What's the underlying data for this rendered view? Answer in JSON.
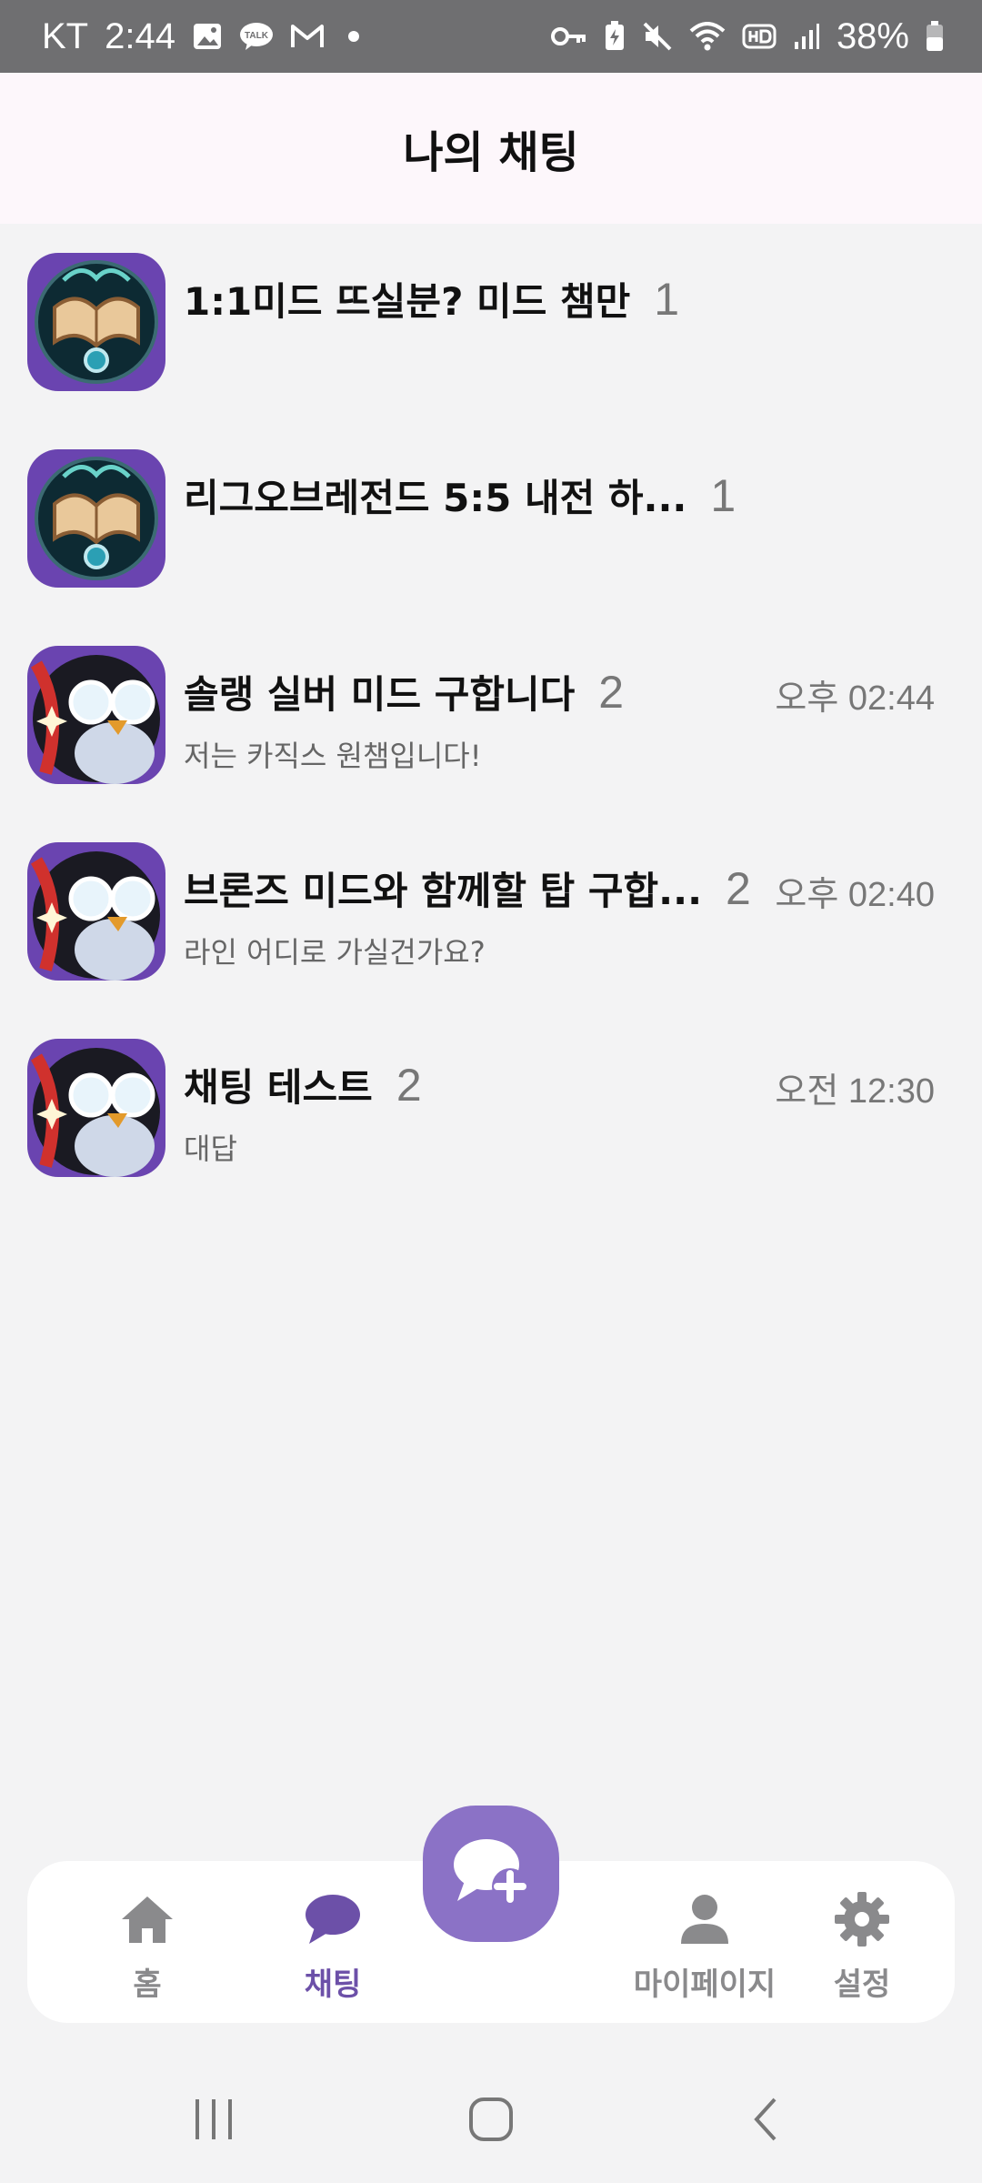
{
  "status_bar": {
    "carrier": "KT",
    "time": "2:44",
    "battery": "38%",
    "left_icons": [
      "image-icon",
      "talk-icon",
      "gmail-icon",
      "dot-icon"
    ],
    "right_icons": [
      "key-icon",
      "battery-saver-icon",
      "mute-icon",
      "wifi-icon",
      "hd-icon",
      "signal-icon",
      "battery-icon"
    ],
    "talk_badge": "TALK"
  },
  "header": {
    "title": "나의 채팅"
  },
  "chats": [
    {
      "title": "1:1미드 뜨실분? 미드 챔만",
      "count": "1",
      "time": "",
      "preview": "",
      "avatar": "book-emblem"
    },
    {
      "title": "리그오브레전드 5:5 내전 하...",
      "count": "1",
      "time": "",
      "preview": "",
      "avatar": "book-emblem"
    },
    {
      "title": "솔랭 실버 미드 구합니다",
      "count": "2",
      "time": "오후 02:44",
      "preview": "저는 카직스 원챔입니다!",
      "avatar": "penguin"
    },
    {
      "title": "브론즈 미드와 함께할 탑 구합...",
      "count": "2",
      "time": "오후 02:40",
      "preview": "라인 어디로 가실건가요?",
      "avatar": "penguin"
    },
    {
      "title": "채팅 테스트",
      "count": "2",
      "time": "오전 12:30",
      "preview": "대답",
      "avatar": "penguin"
    }
  ],
  "bottom_nav": {
    "items": [
      {
        "label": "홈",
        "icon": "home-icon"
      },
      {
        "label": "채팅",
        "icon": "chat-bubble-icon",
        "active": true
      },
      {
        "label": "마이페이지",
        "icon": "person-icon"
      },
      {
        "label": "설정",
        "icon": "gear-icon"
      }
    ],
    "fab_icon": "new-chat-icon"
  },
  "system_nav": [
    "recents-icon",
    "home-circle-icon",
    "back-icon"
  ],
  "colors": {
    "accent": "#6c50a8",
    "fab": "#8b72c6",
    "status_bar": "#6f6f71",
    "header": "#fdf7fb",
    "background": "#f3f3f4"
  }
}
